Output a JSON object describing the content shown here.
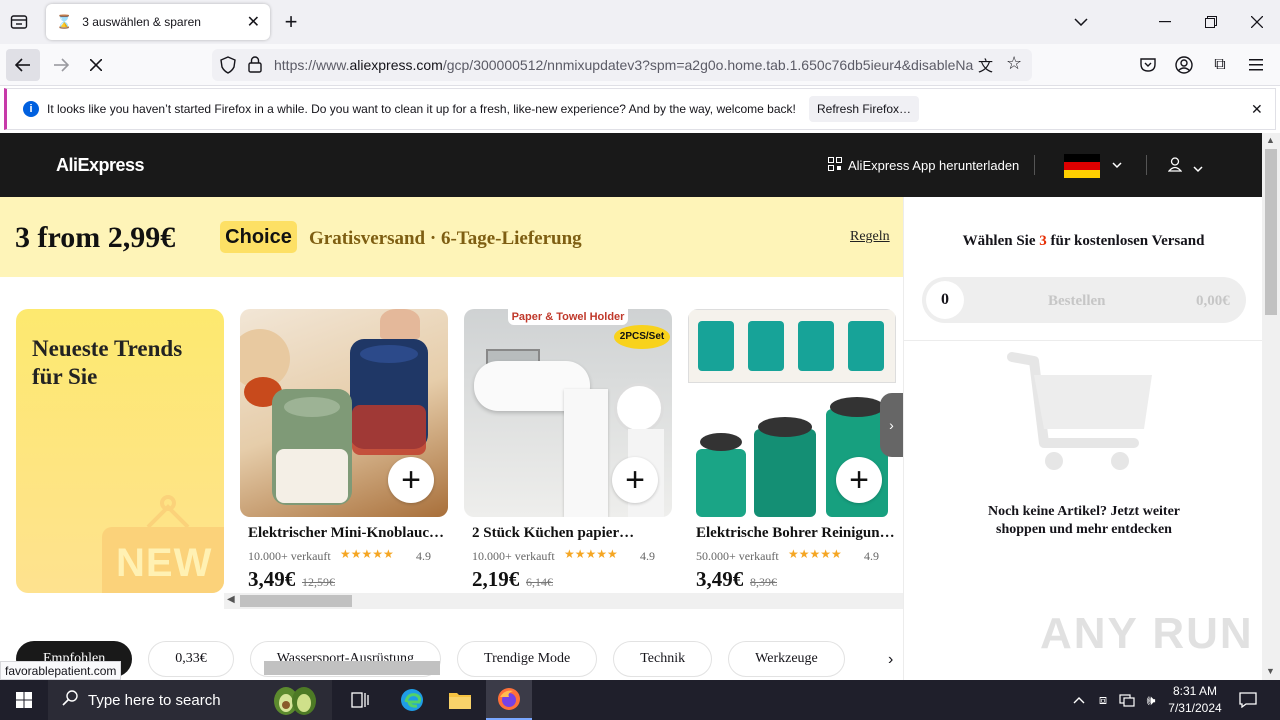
{
  "browser": {
    "tab_title": "3 auswählen & sparen",
    "url_prefix": "https://www.",
    "url_domain": "aliexpress.com",
    "url_rest": "/gcp/300000512/nnmixupdatev3?spm=a2g0o.home.tab.1.650c76db5ieur4&disableNa",
    "notification": "It looks like you haven’t started Firefox in a while. Do you want to clean it up for a fresh, like-new experience? And by the way, welcome back!",
    "refresh_button": "Refresh Firefox…",
    "status_link": "favorablepatient.com"
  },
  "site": {
    "logo": "AliExpress",
    "app_download": "AliExpress App herunterladen",
    "banner": {
      "headline": "3 from 2,99€",
      "choice": "Choice",
      "shipping": "Gratisversand · 6-Tage-Lieferung",
      "rules": "Regeln"
    },
    "trends_title": "Neueste Trends für Sie",
    "trends_badge": "NEW",
    "products": [
      {
        "name": "Elektrischer Mini-Knoblauch…",
        "sold": "10.000+ verkauft",
        "rating": "4.9",
        "price": "3,49€",
        "old_price": "12,59€"
      },
      {
        "name": "2 Stück Küchen papier…",
        "sold": "10.000+ verkauft",
        "rating": "4.9",
        "price": "2,19€",
        "old_price": "6,14€",
        "tag": "Paper & Towel Holder",
        "badge": "2PCS/Set"
      },
      {
        "name": "Elektrische Bohrer Reinigun…",
        "sold": "50.000+ verkauft",
        "rating": "4.9",
        "price": "3,49€",
        "old_price": "8,39€"
      }
    ],
    "categories": [
      "Empfohlen",
      "0,33€",
      "Wassersport-Ausrüstung",
      "Trendige Mode",
      "Technik",
      "Werkzeuge"
    ],
    "cart": {
      "head_pre": "Wählen Sie ",
      "head_num": "3",
      "head_post": " für kostenlosen Versand",
      "count": "0",
      "order_label": "Bestellen",
      "total": "0,00€",
      "empty_text": "Noch keine Artikel? Jetzt weiter shoppen und mehr entdecken"
    }
  },
  "watermark": "ANY RUN",
  "taskbar": {
    "search_placeholder": "Type here to search",
    "time": "8:31 AM",
    "date": "7/31/2024"
  }
}
